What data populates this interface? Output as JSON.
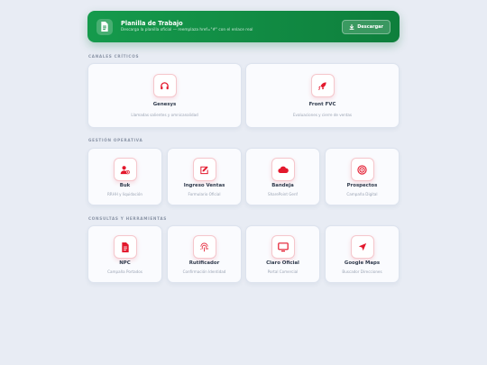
{
  "banner": {
    "title": "Planilla de Trabajo",
    "subtitle": "Descarga la planilla oficial — reemplaza href=\"#\" con el enlace real",
    "button_label": "Descargar"
  },
  "sections": {
    "canales": "CANALES CRÍTICOS",
    "gestion": "GESTIÓN OPERATIVA",
    "consultas": "CONSULTAS Y HERRAMIENTAS"
  },
  "cards": {
    "genesys": {
      "title": "Genesys",
      "subtitle": "Llamadas salientes y omnicanalidad",
      "icon": "headset-icon"
    },
    "front_fvc": {
      "title": "Front FVC",
      "subtitle": "Evaluaciones y cierre de ventas",
      "icon": "rocket-icon"
    },
    "buk": {
      "title": "Buk",
      "subtitle": "RRHH y liquidación",
      "icon": "user-plus-icon"
    },
    "ingreso_ventas": {
      "title": "Ingreso Ventas",
      "subtitle": "Formulario Oficial",
      "icon": "edit-icon"
    },
    "bandeja": {
      "title": "Bandeja",
      "subtitle": "SharePoint Genf",
      "icon": "cloud-icon"
    },
    "prospectos": {
      "title": "Prospectos",
      "subtitle": "Campaña Digital",
      "icon": "target-icon"
    },
    "npc": {
      "title": "NPC",
      "subtitle": "Campaña Portados",
      "icon": "document-icon"
    },
    "rutificador": {
      "title": "Rutificador",
      "subtitle": "Confirmación Identidad",
      "icon": "fingerprint-icon"
    },
    "claro_oficial": {
      "title": "Claro Oficial",
      "subtitle": "Portal Comercial",
      "icon": "monitor-icon"
    },
    "google_maps": {
      "title": "Google Maps",
      "subtitle": "Buscador Direcciones",
      "icon": "location-arrow-icon"
    }
  },
  "colors": {
    "accent": "#e3192d",
    "banner": "#128a44",
    "background": "#e8ecf4"
  }
}
